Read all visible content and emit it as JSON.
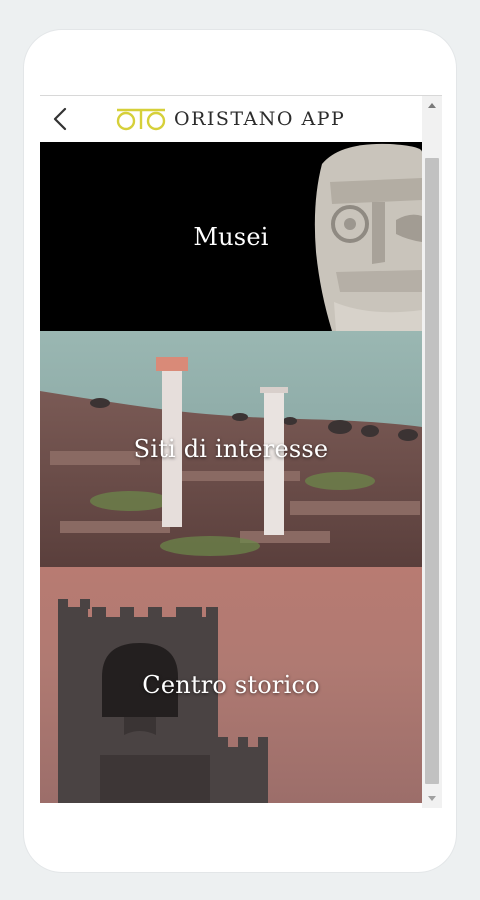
{
  "app": {
    "title": "Oristano App"
  },
  "header": {
    "back_icon": "back-chevron-icon",
    "logo_icon": "oto-logo-icon"
  },
  "tiles": [
    {
      "label": "Musei"
    },
    {
      "label": "Siti di interesse"
    },
    {
      "label": "Centro storico"
    }
  ],
  "colors": {
    "logo": "#d6d03a",
    "title": "#2c2c2c",
    "museums_bg": "#000000",
    "center_bg": "#b47a72"
  }
}
